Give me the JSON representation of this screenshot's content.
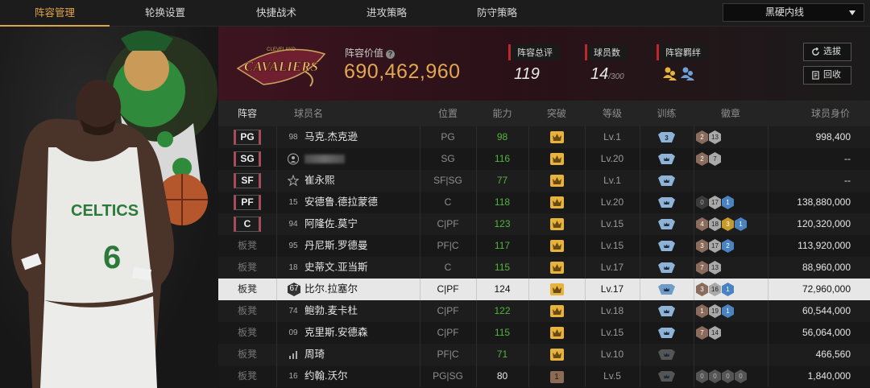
{
  "tabs": [
    {
      "label": "阵容管理",
      "active": true
    },
    {
      "label": "轮换设置",
      "active": false
    },
    {
      "label": "快捷战术",
      "active": false
    },
    {
      "label": "进攻策略",
      "active": false
    },
    {
      "label": "防守策略",
      "active": false
    }
  ],
  "strategy_select": {
    "value": "黑硬内线"
  },
  "team": {
    "logo_text": "CAVALIERS",
    "logo_subtext": "CLEVELAND",
    "value_label": "阵容价值",
    "value": "690,462,960",
    "stats": [
      {
        "label": "阵容总评",
        "value": "119",
        "suffix": ""
      },
      {
        "label": "球员数",
        "value": "14",
        "suffix": "/300"
      },
      {
        "label": "阵容羁绊",
        "value": "",
        "suffix": ""
      }
    ],
    "buttons": {
      "pick": "选拔",
      "recycle": "回收"
    }
  },
  "columns": [
    "阵容",
    "球员名",
    "位置",
    "能力",
    "突破",
    "等级",
    "训练",
    "徽章",
    "球员身价"
  ],
  "players": [
    {
      "slot": "PG",
      "starter": true,
      "number": "98",
      "name": "马克.杰克逊",
      "position": "PG",
      "ability": "98",
      "ability_color": "green",
      "crown": "gold",
      "level": "Lv.1",
      "train": "3",
      "badges": [
        {
          "t": "bronze",
          "v": "2"
        },
        {
          "t": "silver",
          "v": "13"
        }
      ],
      "salary": "998,400"
    },
    {
      "slot": "SG",
      "starter": true,
      "number": "",
      "icon": "person",
      "name": "",
      "blurred": true,
      "position": "SG",
      "ability": "116",
      "ability_color": "green",
      "crown": "gold",
      "level": "Lv.20",
      "train": "",
      "badges": [
        {
          "t": "bronze",
          "v": "2"
        },
        {
          "t": "silver",
          "v": "7"
        }
      ],
      "salary": "--"
    },
    {
      "slot": "SF",
      "starter": true,
      "number": "",
      "icon": "star",
      "name": "崔永熙",
      "position": "SF|SG",
      "ability": "77",
      "ability_color": "green",
      "crown": "gold",
      "level": "Lv.1",
      "train": "",
      "badges": [],
      "salary": "--"
    },
    {
      "slot": "PF",
      "starter": true,
      "number": "15",
      "name": "安德鲁.德拉蒙德",
      "position": "C",
      "ability": "118",
      "ability_color": "green",
      "crown": "gold",
      "level": "Lv.20",
      "train": "",
      "badges": [
        {
          "t": "dark",
          "v": "0"
        },
        {
          "t": "silver",
          "v": "17"
        },
        {
          "t": "blue",
          "v": "1"
        }
      ],
      "salary": "138,880,000"
    },
    {
      "slot": "C",
      "starter": true,
      "number": "94",
      "name": "阿隆佐.莫宁",
      "position": "C|PF",
      "ability": "123",
      "ability_color": "green",
      "crown": "gold",
      "level": "Lv.15",
      "train": "",
      "badges": [
        {
          "t": "bronze",
          "v": "4"
        },
        {
          "t": "silver",
          "v": "18"
        },
        {
          "t": "gold",
          "v": "3"
        },
        {
          "t": "blue",
          "v": "1"
        }
      ],
      "salary": "120,320,000"
    },
    {
      "slot": "板凳",
      "starter": false,
      "number": "95",
      "name": "丹尼斯.罗德曼",
      "position": "PF|C",
      "ability": "117",
      "ability_color": "green",
      "crown": "gold",
      "level": "Lv.15",
      "train": "",
      "badges": [
        {
          "t": "bronze",
          "v": "3"
        },
        {
          "t": "silver",
          "v": "17"
        },
        {
          "t": "blue",
          "v": "2"
        }
      ],
      "salary": "113,920,000"
    },
    {
      "slot": "板凳",
      "starter": false,
      "number": "18",
      "name": "史蒂文.亚当斯",
      "position": "C",
      "ability": "115",
      "ability_color": "green",
      "crown": "gold",
      "level": "Lv.17",
      "train": "",
      "badges": [
        {
          "t": "bronze",
          "v": "7"
        },
        {
          "t": "silver",
          "v": "13"
        }
      ],
      "salary": "88,960,000"
    },
    {
      "slot": "板凳",
      "starter": false,
      "number": "67",
      "name": "比尔.拉塞尔",
      "position": "C|PF",
      "ability": "124",
      "ability_color": "white",
      "crown": "gold",
      "level": "Lv.17",
      "train": "",
      "badges": [
        {
          "t": "bronze",
          "v": "3"
        },
        {
          "t": "silver",
          "v": "16"
        },
        {
          "t": "blue",
          "v": "1"
        }
      ],
      "salary": "72,960,000",
      "selected": true
    },
    {
      "slot": "板凳",
      "starter": false,
      "number": "74",
      "name": "鲍勃.麦卡杜",
      "position": "C|PF",
      "ability": "122",
      "ability_color": "green",
      "crown": "gold",
      "level": "Lv.18",
      "train": "",
      "badges": [
        {
          "t": "bronze",
          "v": "1"
        },
        {
          "t": "silver",
          "v": "19"
        },
        {
          "t": "blue",
          "v": "1"
        }
      ],
      "salary": "60,544,000"
    },
    {
      "slot": "板凳",
      "starter": false,
      "number": "09",
      "name": "克里斯.安德森",
      "position": "C|PF",
      "ability": "115",
      "ability_color": "green",
      "crown": "gold",
      "level": "Lv.15",
      "train": "",
      "badges": [
        {
          "t": "bronze",
          "v": "7"
        },
        {
          "t": "silver",
          "v": "14"
        }
      ],
      "salary": "56,064,000"
    },
    {
      "slot": "板凳",
      "starter": false,
      "number": "",
      "icon": "bars",
      "name": "周琦",
      "position": "PF|C",
      "ability": "71",
      "ability_color": "green",
      "crown": "gold",
      "level": "Lv.10",
      "train": "grey",
      "badges": [],
      "salary": "466,560"
    },
    {
      "slot": "板凳",
      "starter": false,
      "number": "16",
      "name": "约翰.沃尔",
      "position": "PG|SG",
      "ability": "80",
      "ability_color": "white",
      "crown": "brown",
      "crown_value": "1",
      "level": "Lv.5",
      "train": "grey",
      "badges": [
        {
          "t": "grey",
          "v": "0"
        },
        {
          "t": "grey",
          "v": "0"
        },
        {
          "t": "grey",
          "v": "0"
        },
        {
          "t": "grey",
          "v": "0"
        }
      ],
      "salary": "1,840,000"
    }
  ],
  "colors": {
    "accent": "#e0a44a",
    "team_red": "#6f1f30",
    "gold": "#e6b43d",
    "green": "#53b33f",
    "train_blue": "#8fb3d6"
  }
}
